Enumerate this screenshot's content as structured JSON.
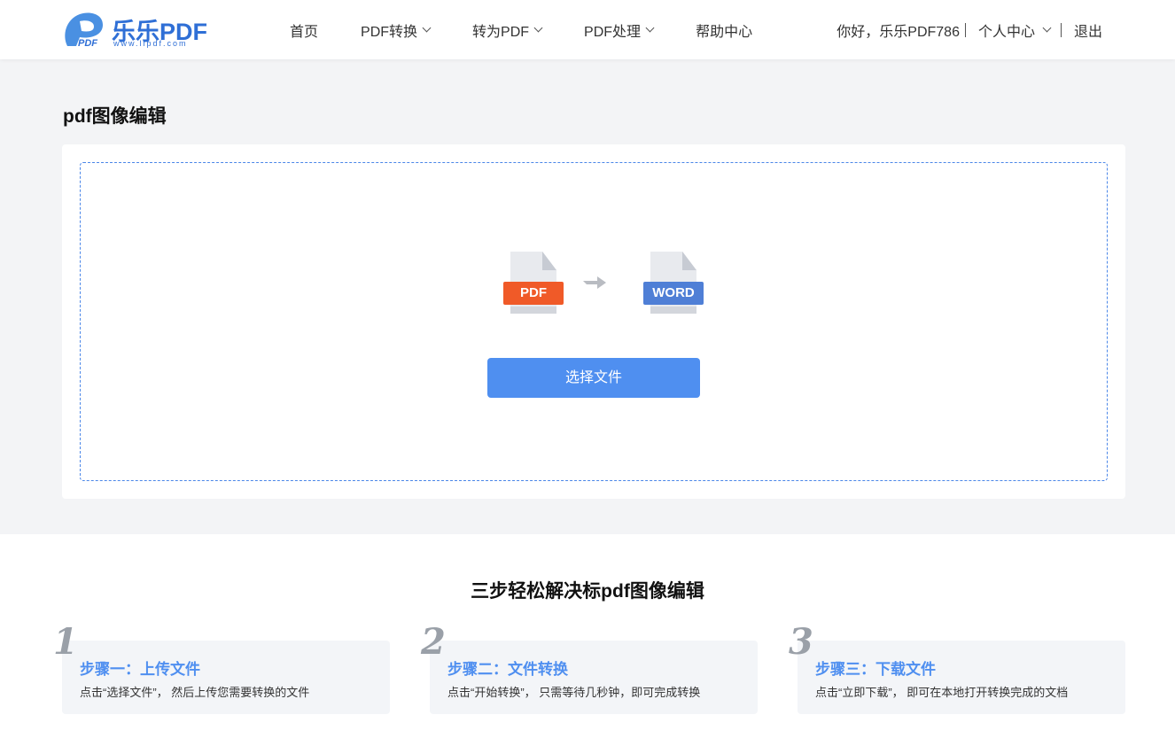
{
  "header": {
    "logo": {
      "brand": "乐乐PDF",
      "url": "www.llpdf.com",
      "mark_text": "PDF",
      "accent": "#2f6fd6"
    },
    "nav": [
      {
        "label": "首页",
        "dropdown": false
      },
      {
        "label": "PDF转换",
        "dropdown": true
      },
      {
        "label": "转为PDF",
        "dropdown": true
      },
      {
        "label": "PDF处理",
        "dropdown": true
      },
      {
        "label": "帮助中心",
        "dropdown": false
      }
    ],
    "user": {
      "greeting": "你好，乐乐PDF786",
      "center": "个人中心",
      "logout": "退出"
    }
  },
  "main": {
    "title": "pdf图像编辑",
    "from_label": "PDF",
    "to_label": "WORD",
    "select_button": "选择文件",
    "colors": {
      "button": "#4f8ff0",
      "pdf": "#f05a28",
      "word": "#4f7fd6",
      "dash": "#4a86e8"
    }
  },
  "steps": {
    "title": "三步轻松解决标pdf图像编辑",
    "items": [
      {
        "num": "1",
        "title": "步骤一：上传文件",
        "desc": "点击“选择文件”， 然后上传您需要转换的文件"
      },
      {
        "num": "2",
        "title": "步骤二：文件转换",
        "desc": "点击“开始转换”， 只需等待几秒钟，即可完成转换"
      },
      {
        "num": "3",
        "title": "步骤三：下载文件",
        "desc": "点击“立即下载”， 即可在本地打开转换完成的文档"
      }
    ]
  }
}
